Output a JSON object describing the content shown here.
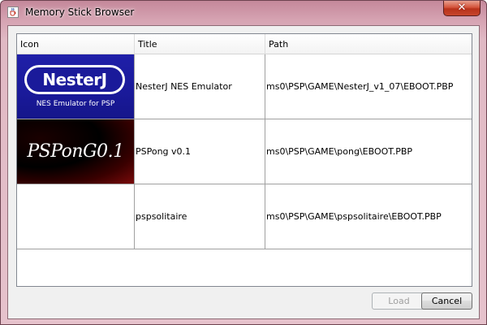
{
  "window": {
    "title": "Memory Stick Browser",
    "close_glyph": "✕",
    "title_icon": "java-cup-icon"
  },
  "table": {
    "columns": [
      "Icon",
      "Title",
      "Path"
    ],
    "rows": [
      {
        "icon": "nesterj-logo",
        "logo_name": "NesterJ",
        "logo_sub": "NES Emulator for PSP",
        "title": "NesterJ NES Emulator",
        "path": "ms0\\PSP\\GAME\\NesterJ_v1_07\\EBOOT.PBP"
      },
      {
        "icon": "pspong-logo",
        "logo_name": "PSPonG0.1",
        "title": "PSPong v0.1",
        "path": "ms0\\PSP\\GAME\\pong\\EBOOT.PBP"
      },
      {
        "icon": "",
        "title": "pspsolitaire",
        "path": "ms0\\PSP\\GAME\\pspsolitaire\\EBOOT.PBP"
      }
    ]
  },
  "buttons": {
    "load_label": "Load",
    "load_enabled": false,
    "cancel_label": "Cancel"
  },
  "colors": {
    "nesterj_bg": "#1a1a9a",
    "pspong_bg": "#000000",
    "title_bar": "#d6a3b2",
    "close_button": "#c7452c"
  }
}
